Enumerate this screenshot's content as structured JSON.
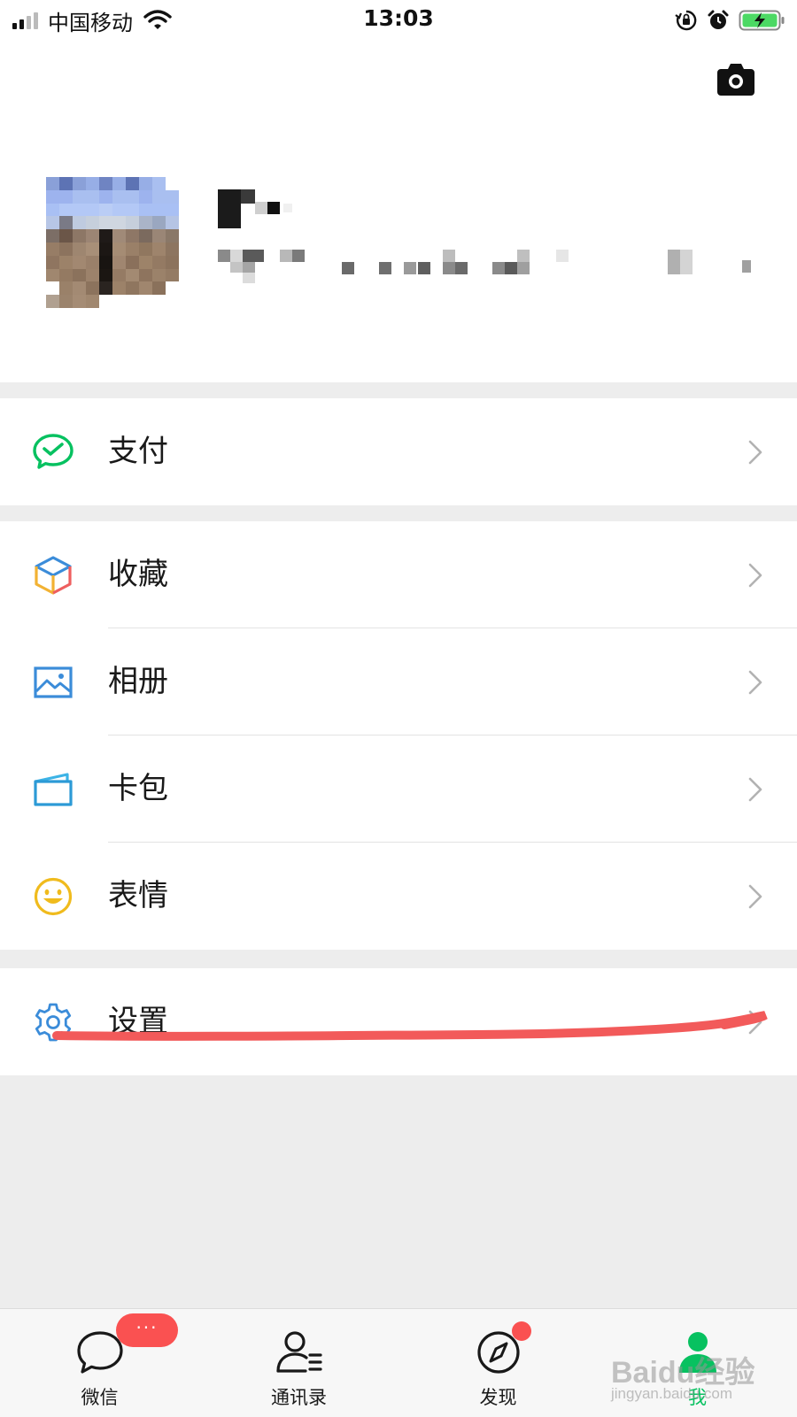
{
  "status_bar": {
    "carrier": "中国移动",
    "time": "13:03",
    "icons": [
      "signal-icon",
      "wifi-icon",
      "orientation-lock-icon",
      "alarm-icon",
      "battery-charging-icon"
    ]
  },
  "profile": {
    "camera_icon": "camera-icon",
    "avatar": "pixelated-avatar",
    "nickname": "pixelated",
    "wechat_id": "pixelated"
  },
  "menu": {
    "groups": [
      [
        {
          "label": "支付",
          "icon": "pay-icon"
        }
      ],
      [
        {
          "label": "收藏",
          "icon": "favorites-icon"
        },
        {
          "label": "相册",
          "icon": "album-icon"
        },
        {
          "label": "卡包",
          "icon": "card-wallet-icon"
        },
        {
          "label": "表情",
          "icon": "sticker-icon"
        }
      ],
      [
        {
          "label": "设置",
          "icon": "settings-icon"
        }
      ]
    ]
  },
  "annotation": {
    "color": "#f25a5a"
  },
  "tab_bar": {
    "tabs": [
      {
        "label": "微信",
        "icon": "chat-icon",
        "badge": "···"
      },
      {
        "label": "通讯录",
        "icon": "contacts-icon"
      },
      {
        "label": "发现",
        "icon": "discover-icon",
        "dot": true
      },
      {
        "label": "我",
        "icon": "me-icon",
        "active": true
      }
    ]
  },
  "watermark": {
    "logo": "Baidu经验",
    "url": "jingyan.baidu.com"
  },
  "colors": {
    "accent": "#07c160",
    "badge": "#fa5151",
    "background": "#ededed",
    "settings_icon": "#3b8cd9"
  }
}
